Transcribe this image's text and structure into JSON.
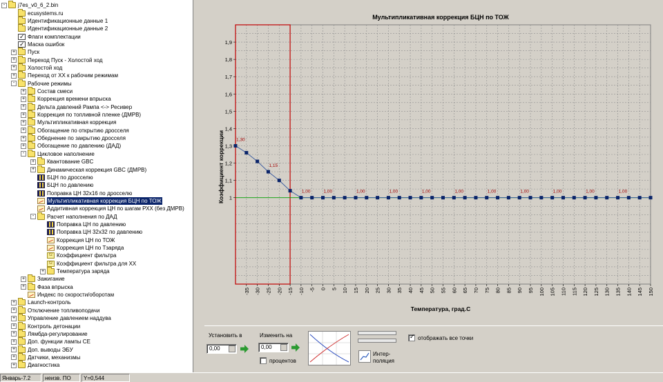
{
  "tree": {
    "root_label": "j7es_v0_6_2.bin",
    "items": [
      {
        "label": "ecusystems.ru",
        "icon": "folder",
        "level": 1,
        "exp": ""
      },
      {
        "label": "Идентификационные данные 1",
        "icon": "folder",
        "level": 1,
        "exp": ""
      },
      {
        "label": "Идентификационные данные 2",
        "icon": "folder",
        "level": 1,
        "exp": ""
      },
      {
        "label": "Флаги комплектации",
        "icon": "check",
        "level": 1,
        "exp": ""
      },
      {
        "label": "Маска ошибок",
        "icon": "check",
        "level": 1,
        "exp": ""
      },
      {
        "label": "Пуск",
        "icon": "folder",
        "level": 1,
        "exp": "+"
      },
      {
        "label": "Переход Пуск - Холостой ход",
        "icon": "folder",
        "level": 1,
        "exp": "+"
      },
      {
        "label": "Холостой ход",
        "icon": "folder",
        "level": 1,
        "exp": "+"
      },
      {
        "label": "Переход от ХХ к рабочим режимам",
        "icon": "folder",
        "level": 1,
        "exp": "+"
      },
      {
        "label": "Рабочие режимы",
        "icon": "folder",
        "level": 1,
        "exp": "-"
      },
      {
        "label": "Состав смеси",
        "icon": "folder",
        "level": 2,
        "exp": "+"
      },
      {
        "label": "Коррекция времени впрыска",
        "icon": "folder",
        "level": 2,
        "exp": "+"
      },
      {
        "label": "Дельта давлений Рампа <-> Ресивер",
        "icon": "folder",
        "level": 2,
        "exp": "+"
      },
      {
        "label": "Коррекция по топливной пленке (ДМРВ)",
        "icon": "folder",
        "level": 2,
        "exp": "+"
      },
      {
        "label": "Мультипликативная коррекция",
        "icon": "folder",
        "level": 2,
        "exp": "+"
      },
      {
        "label": "Обогащение по открытию дросселя",
        "icon": "folder",
        "level": 2,
        "exp": "+"
      },
      {
        "label": "Обеднение по закрытию дросселя",
        "icon": "folder",
        "level": 2,
        "exp": "+"
      },
      {
        "label": "Обогащение по давлению (ДАД)",
        "icon": "folder",
        "level": 2,
        "exp": "+"
      },
      {
        "label": "Цикловое наполнение",
        "icon": "folder",
        "level": 2,
        "exp": "-"
      },
      {
        "label": "Квантование GBC",
        "icon": "folder",
        "level": 3,
        "exp": "+"
      },
      {
        "label": "Динамическая коррекция GBC (ДМРВ)",
        "icon": "folder",
        "level": 3,
        "exp": "+"
      },
      {
        "label": "БЦН по дросселю",
        "icon": "table",
        "level": 3,
        "exp": ""
      },
      {
        "label": "БЦН по давлению",
        "icon": "table",
        "level": 3,
        "exp": ""
      },
      {
        "label": "Поправка ЦН 32x16 по дросселю",
        "icon": "table",
        "level": 3,
        "exp": ""
      },
      {
        "label": "Мультипликативная коррекция БЦН по ТОЖ",
        "icon": "graph",
        "level": 3,
        "exp": "",
        "selected": true
      },
      {
        "label": "Аддитивная коррекция ЦН по шагам РХХ (без ДМРВ)",
        "icon": "graph",
        "level": 3,
        "exp": ""
      },
      {
        "label": "Расчет наполнения по ДАД",
        "icon": "folder",
        "level": 3,
        "exp": "-"
      },
      {
        "label": "Поправка ЦН по давлению",
        "icon": "table",
        "level": 4,
        "exp": ""
      },
      {
        "label": "Поправка ЦН 32x32 по давлению",
        "icon": "table",
        "level": 4,
        "exp": ""
      },
      {
        "label": "Коррекция ЦН по ТОЖ",
        "icon": "graph",
        "level": 4,
        "exp": ""
      },
      {
        "label": "Коррекция ЦН по Тзаряда",
        "icon": "graph",
        "level": 4,
        "exp": ""
      },
      {
        "label": "Коэффициент фильтра",
        "icon": "coef",
        "level": 4,
        "exp": ""
      },
      {
        "label": "Коэффициент фильтра для ХХ",
        "icon": "coef",
        "level": 4,
        "exp": ""
      },
      {
        "label": "Температура заряда",
        "icon": "folder",
        "level": 4,
        "exp": "+"
      },
      {
        "label": "Зажигание",
        "icon": "folder",
        "level": 2,
        "exp": "+"
      },
      {
        "label": "Фаза впрыска",
        "icon": "folder",
        "level": 2,
        "exp": "+"
      },
      {
        "label": "Индекс по скорости/оборотам",
        "icon": "graph",
        "level": 2,
        "exp": ""
      },
      {
        "label": "Launch-контроль",
        "icon": "folder",
        "level": 1,
        "exp": "+"
      },
      {
        "label": "Отключение топливоподачи",
        "icon": "folder",
        "level": 1,
        "exp": "+"
      },
      {
        "label": "Управление давлением наддува",
        "icon": "folder",
        "level": 1,
        "exp": "+"
      },
      {
        "label": "Контроль детонации",
        "icon": "folder",
        "level": 1,
        "exp": "+"
      },
      {
        "label": "Лямбда-регулирование",
        "icon": "folder",
        "level": 1,
        "exp": "+"
      },
      {
        "label": "Доп. функции лампы CE",
        "icon": "folder",
        "level": 1,
        "exp": "+"
      },
      {
        "label": "Доп. выводы ЭБУ",
        "icon": "folder",
        "level": 1,
        "exp": "+"
      },
      {
        "label": "Датчики, механизмы",
        "icon": "folder",
        "level": 1,
        "exp": "+"
      },
      {
        "label": "Диагностика",
        "icon": "folder",
        "level": 1,
        "exp": "+"
      }
    ]
  },
  "chart_data": {
    "type": "line",
    "title": "Мультипликативная коррекция БЦН по ТОЖ",
    "xlabel": "Температура, град.С",
    "ylabel": "Коэффициент коррекции",
    "x": [
      -40,
      -35,
      -30,
      -25,
      -20,
      -15,
      -10,
      -5,
      0,
      5,
      10,
      15,
      20,
      25,
      30,
      35,
      40,
      45,
      50,
      55,
      60,
      65,
      70,
      75,
      80,
      85,
      90,
      95,
      100,
      105,
      110,
      115,
      120,
      125,
      130,
      135,
      140,
      145,
      150
    ],
    "x_ticks": [
      -35,
      -30,
      -25,
      -20,
      -15,
      -10,
      -5,
      0,
      5,
      10,
      15,
      20,
      25,
      30,
      35,
      40,
      45,
      50,
      55,
      60,
      65,
      70,
      75,
      80,
      85,
      90,
      95,
      100,
      105,
      110,
      115,
      120,
      125,
      130,
      135,
      140,
      145,
      150
    ],
    "series": [
      {
        "values": [
          1.3,
          1.26,
          1.21,
          1.15,
          1.1,
          1.04,
          1.0,
          1.0,
          1.0,
          1.0,
          1.0,
          1.0,
          1.0,
          1.0,
          1.0,
          1.0,
          1.0,
          1.0,
          1.0,
          1.0,
          1.0,
          1.0,
          1.0,
          1.0,
          1.0,
          1.0,
          1.0,
          1.0,
          1.0,
          1.0,
          1.0,
          1.0,
          1.0,
          1.0,
          1.0,
          1.0,
          1.0,
          1.0,
          1.0
        ]
      }
    ],
    "data_labels": [
      {
        "x": -40,
        "text": "1,30"
      },
      {
        "x": -25,
        "text": "1,15"
      },
      {
        "x": -10,
        "text": "1,00"
      },
      {
        "x": 0,
        "text": "1,00"
      },
      {
        "x": 15,
        "text": "1,00"
      },
      {
        "x": 30,
        "text": "1,00"
      },
      {
        "x": 45,
        "text": "1,00"
      },
      {
        "x": 60,
        "text": "1,00"
      },
      {
        "x": 75,
        "text": "1,00"
      },
      {
        "x": 90,
        "text": "1,00"
      },
      {
        "x": 105,
        "text": "1,00"
      },
      {
        "x": 120,
        "text": "1,00"
      },
      {
        "x": 135,
        "text": "1,00"
      }
    ],
    "y_ticks": [
      "1",
      "1,1",
      "1,2",
      "1,3",
      "1,4",
      "1,5",
      "1,6",
      "1,7",
      "1,8",
      "1,9"
    ],
    "ylim": [
      0.5,
      2.0
    ],
    "xlim": [
      -40,
      150
    ],
    "selection_range": [
      -40,
      -15
    ],
    "reference_y": 1.0,
    "grid": true,
    "colors": {
      "line": "#4060a0",
      "marker": "#0a246a",
      "label": "#a00000",
      "selection": "#c00000",
      "reference": "#00a000"
    }
  },
  "controls": {
    "set_label": "Установить в",
    "set_value": "0,00",
    "change_label": "Изменить на",
    "change_value": "0,00",
    "percent_label": "процентов",
    "interp_label_1": "Интер-",
    "interp_label_2": "поляция",
    "show_all_label": "отображать все точки",
    "show_all_checked": true
  },
  "status": {
    "month": "Январь-7.2",
    "state": "неизв. ПО",
    "y_value": "Y=0,544"
  }
}
